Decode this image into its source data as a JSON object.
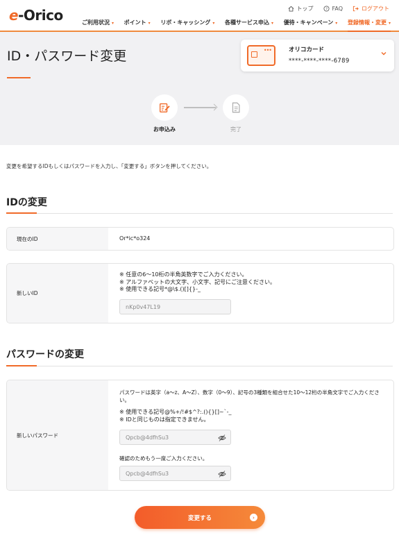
{
  "header": {
    "logo_prefix": "e",
    "logo_text": "-Orico",
    "util_links": [
      "トップ",
      "FAQ",
      "ログアウト"
    ],
    "nav": [
      {
        "label": "ご利用状況",
        "active": false
      },
      {
        "label": "ポイント",
        "active": false
      },
      {
        "label": "リボ・キャッシング",
        "active": false
      },
      {
        "label": "各種サービス申込",
        "active": false
      },
      {
        "label": "優待・キャンペーン",
        "active": false
      },
      {
        "label": "登録情報・変更",
        "active": true
      }
    ],
    "nav_arrow": "▾"
  },
  "page": {
    "title": "ID・パスワード変更"
  },
  "card": {
    "name": "オリコカード",
    "number": "****-****-****-6789",
    "dots": "•••"
  },
  "steps": [
    {
      "label": "お申込み",
      "icon": "pencil-form-icon",
      "active": true
    },
    {
      "label": "完了",
      "icon": "document-icon",
      "active": false
    }
  ],
  "intro": "変更を希望するIDもしくはパスワードを入力し、「変更する」ボタンを押してください。",
  "id_section": {
    "title": "IDの変更",
    "current_label": "現在のID",
    "current_value": "Or*ic*o324",
    "new_label": "新しいID",
    "notes": [
      "※ 任意の6～10桁の半角英数字でご入力ください。",
      "※ アルファベットの大文字、小文字、記号にご注意ください。",
      "※ 使用できる記号*@\\$.()[]{}-_"
    ],
    "new_placeholder": "nKp0v47L19"
  },
  "pw_section": {
    "title": "パスワードの変更",
    "new_label": "新しいパスワード",
    "rule_line1": "パスワードは英字（a～z、A～Z）、数字（0～9）、記号の3種類を組合せた10～12桁の半角文字でご入力くださ",
    "rule_line2": "い。",
    "notes": [
      "※ 使用できる記号@%+/!#$^?:.(){}[]~`-_",
      "※ IDと同じものは指定できません。"
    ],
    "pw_placeholder": "Qpcb@4dfhSu3",
    "confirm_label": "確認のためもう一度ご入力ください。",
    "confirm_placeholder": "Qpcb@4dfhSu3"
  },
  "submit_label": "変更する",
  "colors": {
    "accent": "#f06a28",
    "band": "#f1f1f3",
    "label_bg": "#f6f6f7"
  }
}
